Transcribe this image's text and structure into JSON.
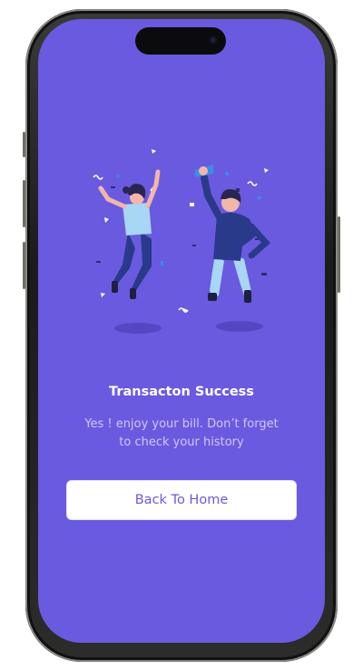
{
  "result": {
    "title": "Transacton Success",
    "message": "Yes ! enjoy your bill. Don’t forget to check your history",
    "back_button_label": "Back To Home"
  },
  "colors": {
    "background": "#6a5ae0",
    "button_bg": "#ffffff",
    "button_text": "#6a5ae0"
  }
}
